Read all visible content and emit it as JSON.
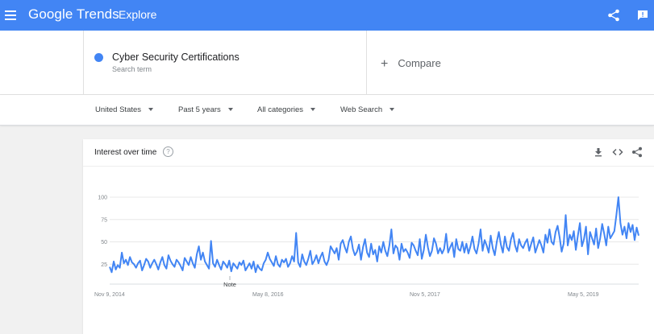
{
  "header": {
    "logo_text": "Google Trends",
    "page_label": "Explore"
  },
  "search_term": {
    "name": "Cyber Security Certifications",
    "subtitle": "Search term",
    "color": "#4285f4"
  },
  "compare": {
    "plus": "+",
    "label": "Compare"
  },
  "filters": {
    "region": "United States",
    "time_range": "Past 5 years",
    "category": "All categories",
    "search_type": "Web Search"
  },
  "card": {
    "title": "Interest over time",
    "help": "?",
    "note_label": "Note"
  },
  "chart_data": {
    "type": "line",
    "title": "Interest over time",
    "ylim": [
      0,
      100
    ],
    "y_ticks": [
      "100",
      "75",
      "50",
      "25"
    ],
    "x_ticks": [
      "Nov 9, 2014",
      "May 8, 2016",
      "Nov 5, 2017",
      "May 5, 2019"
    ],
    "grid": true,
    "series": [
      {
        "name": "Cyber Security Certifications",
        "color": "#4285f4",
        "values": [
          22,
          16,
          28,
          19,
          24,
          21,
          38,
          26,
          30,
          24,
          33,
          27,
          25,
          21,
          26,
          29,
          18,
          24,
          31,
          28,
          21,
          26,
          30,
          25,
          19,
          27,
          33,
          24,
          20,
          35,
          29,
          25,
          22,
          30,
          27,
          23,
          18,
          32,
          28,
          24,
          33,
          26,
          21,
          36,
          45,
          30,
          38,
          28,
          24,
          20,
          51,
          26,
          22,
          30,
          24,
          19,
          28,
          25,
          21,
          29,
          17,
          26,
          23,
          20,
          27,
          24,
          29,
          18,
          22,
          26,
          20,
          28,
          16,
          24,
          20,
          18,
          26,
          30,
          38,
          31,
          27,
          23,
          34,
          25,
          22,
          30,
          27,
          31,
          22,
          26,
          34,
          28,
          60,
          27,
          22,
          36,
          28,
          24,
          31,
          40,
          25,
          29,
          35,
          26,
          33,
          38,
          28,
          24,
          30,
          45,
          41,
          37,
          43,
          30,
          48,
          52,
          44,
          38,
          50,
          56,
          42,
          35,
          39,
          47,
          30,
          44,
          53,
          38,
          33,
          48,
          36,
          41,
          28,
          45,
          38,
          50,
          40,
          34,
          46,
          64,
          37,
          46,
          43,
          30,
          48,
          39,
          42,
          38,
          32,
          49,
          46,
          40,
          35,
          53,
          31,
          41,
          58,
          44,
          34,
          40,
          54,
          48,
          37,
          43,
          37,
          42,
          59,
          38,
          44,
          49,
          33,
          53,
          42,
          40,
          50,
          38,
          48,
          37,
          45,
          56,
          42,
          37,
          48,
          64,
          40,
          52,
          46,
          38,
          57,
          43,
          35,
          50,
          61,
          47,
          38,
          56,
          44,
          40,
          53,
          60,
          46,
          39,
          53,
          46,
          43,
          49,
          53,
          40,
          48,
          55,
          38,
          45,
          52,
          46,
          38,
          58,
          49,
          64,
          50,
          47,
          61,
          68,
          55,
          39,
          48,
          80,
          46,
          58,
          52,
          62,
          41,
          57,
          71,
          45,
          53,
          67,
          36,
          61,
          54,
          47,
          65,
          43,
          54,
          70,
          59,
          46,
          67,
          54,
          58,
          62,
          80,
          100,
          71,
          58,
          67,
          54,
          71,
          61,
          69,
          52,
          66,
          57
        ]
      }
    ]
  }
}
